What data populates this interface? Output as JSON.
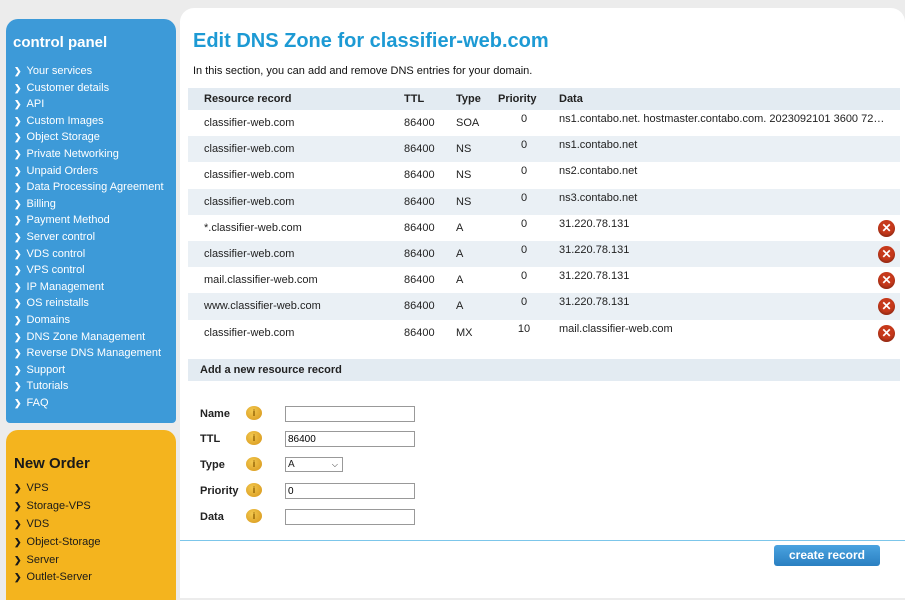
{
  "control_panel": {
    "title": "control panel",
    "items": [
      "Your services",
      "Customer details",
      "API",
      "Custom Images",
      "Object Storage",
      "Private Networking",
      "Unpaid Orders",
      "Data Processing Agreement",
      "Billing",
      "Payment Method",
      "Server control",
      "VDS control",
      "VPS control",
      "IP Management",
      "OS reinstalls",
      "Domains",
      "DNS Zone Management",
      "Reverse DNS Management",
      "Support",
      "Tutorials",
      "FAQ"
    ]
  },
  "new_order": {
    "title": "New Order",
    "items": [
      "VPS",
      "Storage-VPS",
      "VDS",
      "Object-Storage",
      "Server",
      "Outlet-Server"
    ]
  },
  "main": {
    "title": "Edit DNS Zone for classifier-web.com",
    "intro": "In this section, you can add and remove DNS entries for your domain.",
    "columns": {
      "name": "Resource record",
      "ttl": "TTL",
      "type": "Type",
      "priority": "Priority",
      "data": "Data"
    },
    "records": [
      {
        "name": "classifier-web.com",
        "ttl": "86400",
        "type": "SOA",
        "priority": "0",
        "data": "ns1.contabo.net. hostmaster.contabo.com. 2023092101 3600 72…",
        "deletable": false
      },
      {
        "name": "classifier-web.com",
        "ttl": "86400",
        "type": "NS",
        "priority": "0",
        "data": "ns1.contabo.net",
        "deletable": false
      },
      {
        "name": "classifier-web.com",
        "ttl": "86400",
        "type": "NS",
        "priority": "0",
        "data": "ns2.contabo.net",
        "deletable": false
      },
      {
        "name": "classifier-web.com",
        "ttl": "86400",
        "type": "NS",
        "priority": "0",
        "data": "ns3.contabo.net",
        "deletable": false
      },
      {
        "name": "*.classifier-web.com",
        "ttl": "86400",
        "type": "A",
        "priority": "0",
        "data": "31.220.78.131",
        "deletable": true
      },
      {
        "name": "classifier-web.com",
        "ttl": "86400",
        "type": "A",
        "priority": "0",
        "data": "31.220.78.131",
        "deletable": true
      },
      {
        "name": "mail.classifier-web.com",
        "ttl": "86400",
        "type": "A",
        "priority": "0",
        "data": "31.220.78.131",
        "deletable": true
      },
      {
        "name": "www.classifier-web.com",
        "ttl": "86400",
        "type": "A",
        "priority": "0",
        "data": "31.220.78.131",
        "deletable": true
      },
      {
        "name": "classifier-web.com",
        "ttl": "86400",
        "type": "MX",
        "priority": "10",
        "data": "mail.classifier-web.com",
        "deletable": true
      }
    ],
    "add_section_title": "Add a new resource record",
    "form": {
      "name_label": "Name",
      "name_value": "",
      "ttl_label": "TTL",
      "ttl_value": "86400",
      "type_label": "Type",
      "type_value": "A",
      "priority_label": "Priority",
      "priority_value": "0",
      "data_label": "Data",
      "data_value": ""
    },
    "create_button": "create record"
  },
  "colors": {
    "accent": "#1d9ad4",
    "sidebar_blue": "#3d9ad8",
    "sidebar_orange": "#f4b41e",
    "delete_red": "#c6391b"
  },
  "icons": {
    "nav_bullet": "chevron-right-icon",
    "delete": "delete-circle-x-icon",
    "info": "info-bubble-icon"
  }
}
